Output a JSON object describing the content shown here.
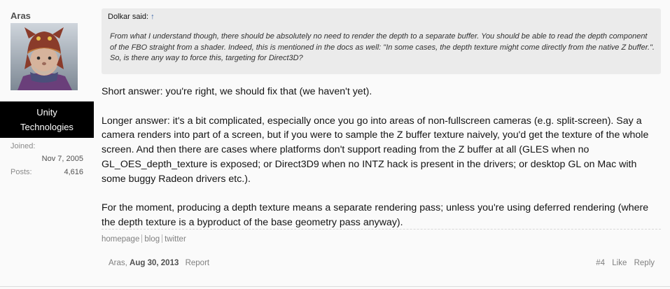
{
  "user": {
    "name": "Aras",
    "title_line1": "Unity",
    "title_line2": "Technologies",
    "joined_label": "Joined:",
    "joined_value": "Nov 7, 2005",
    "posts_label": "Posts:",
    "posts_value": "4,616"
  },
  "quote": {
    "author_said": "Dolkar said:",
    "arrow_glyph": "↑",
    "text": "From what I understand though, there should be absolutely no need to render the depth to a separate buffer. You should be able to read the depth component of the FBO straight from a shader. Indeed, this is mentioned in the docs as well: \"In some cases, the depth texture might come directly from the native Z buffer.\". So, is there any way to force this, targeting for Direct3D?"
  },
  "message": {
    "p1": "Short answer: you're right, we should fix that (we haven't yet).",
    "p2": "Longer answer: it's a bit complicated, especially once you go into areas of non-fullscreen cameras (e.g. split-screen). Say a camera renders into part of a screen, but if you were to sample the Z buffer texture naively, you'd get the texture of the whole screen. And then there are cases where platforms don't support reading from the Z buffer at all (GLES when no GL_OES_depth_texture is exposed; or Direct3D9 when no INTZ hack is present in the drivers; or desktop GL on Mac with some buggy Radeon drivers etc.).",
    "p3": "For the moment, producing a depth texture means a separate rendering pass; unless you're using deferred rendering (where the depth texture is a byproduct of the base geometry pass anyway)."
  },
  "signature": {
    "link1": "homepage",
    "link2": "blog",
    "link3": "twitter"
  },
  "footer": {
    "author": "Aras,",
    "date": "Aug 30, 2013",
    "report": "Report",
    "post_number": "#4",
    "like": "Like",
    "reply": "Reply"
  },
  "colors": {
    "page_bg": "#fafafa",
    "quote_bg": "#ebebeb",
    "user_title_bg": "#000000",
    "link_blue": "#3a66a8"
  }
}
